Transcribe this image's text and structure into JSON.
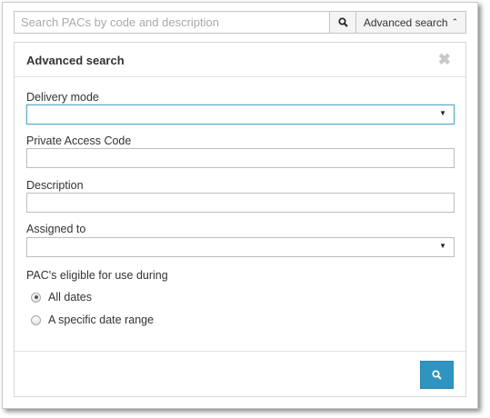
{
  "search": {
    "placeholder": "Search PACs by code and description",
    "search_icon": "magnifier-icon",
    "advanced_label": "Advanced search",
    "advanced_icon": "chevron-up-icon"
  },
  "panel": {
    "title": "Advanced search",
    "close_icon": "close-x-icon",
    "fields": {
      "delivery_mode_label": "Delivery mode",
      "delivery_mode_value": "",
      "pac_label": "Private Access Code",
      "pac_value": "",
      "description_label": "Description",
      "description_value": "",
      "assigned_to_label": "Assigned to",
      "assigned_to_value": ""
    },
    "eligibility": {
      "label": "PAC's eligible for use during",
      "options": [
        {
          "label": "All dates",
          "checked": true
        },
        {
          "label": "A specific date range",
          "checked": false
        }
      ]
    },
    "submit_icon": "magnifier-icon"
  },
  "colors": {
    "accent": "#2f95c0",
    "focus_border": "#5aa9c9"
  }
}
